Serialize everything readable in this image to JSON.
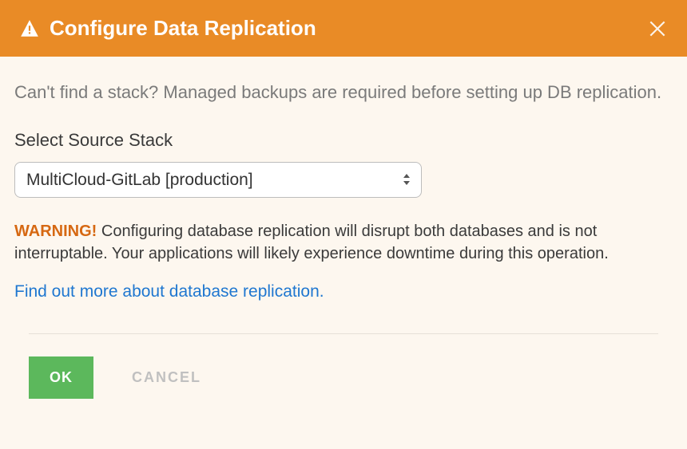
{
  "header": {
    "title": "Configure Data Replication"
  },
  "body": {
    "help_text": "Can't find a stack? Managed backups are required before setting up DB replication.",
    "form": {
      "label": "Select Source Stack",
      "selected_value": "MultiCloud-GitLab [production]"
    },
    "warning": {
      "label": "WARNING!",
      "text": " Configuring database replication will disrupt both databases and is not interruptable. Your applications will likely experience downtime during this operation."
    },
    "learn_more_link": "Find out more about database replication."
  },
  "footer": {
    "ok_label": "OK",
    "cancel_label": "CANCEL"
  }
}
